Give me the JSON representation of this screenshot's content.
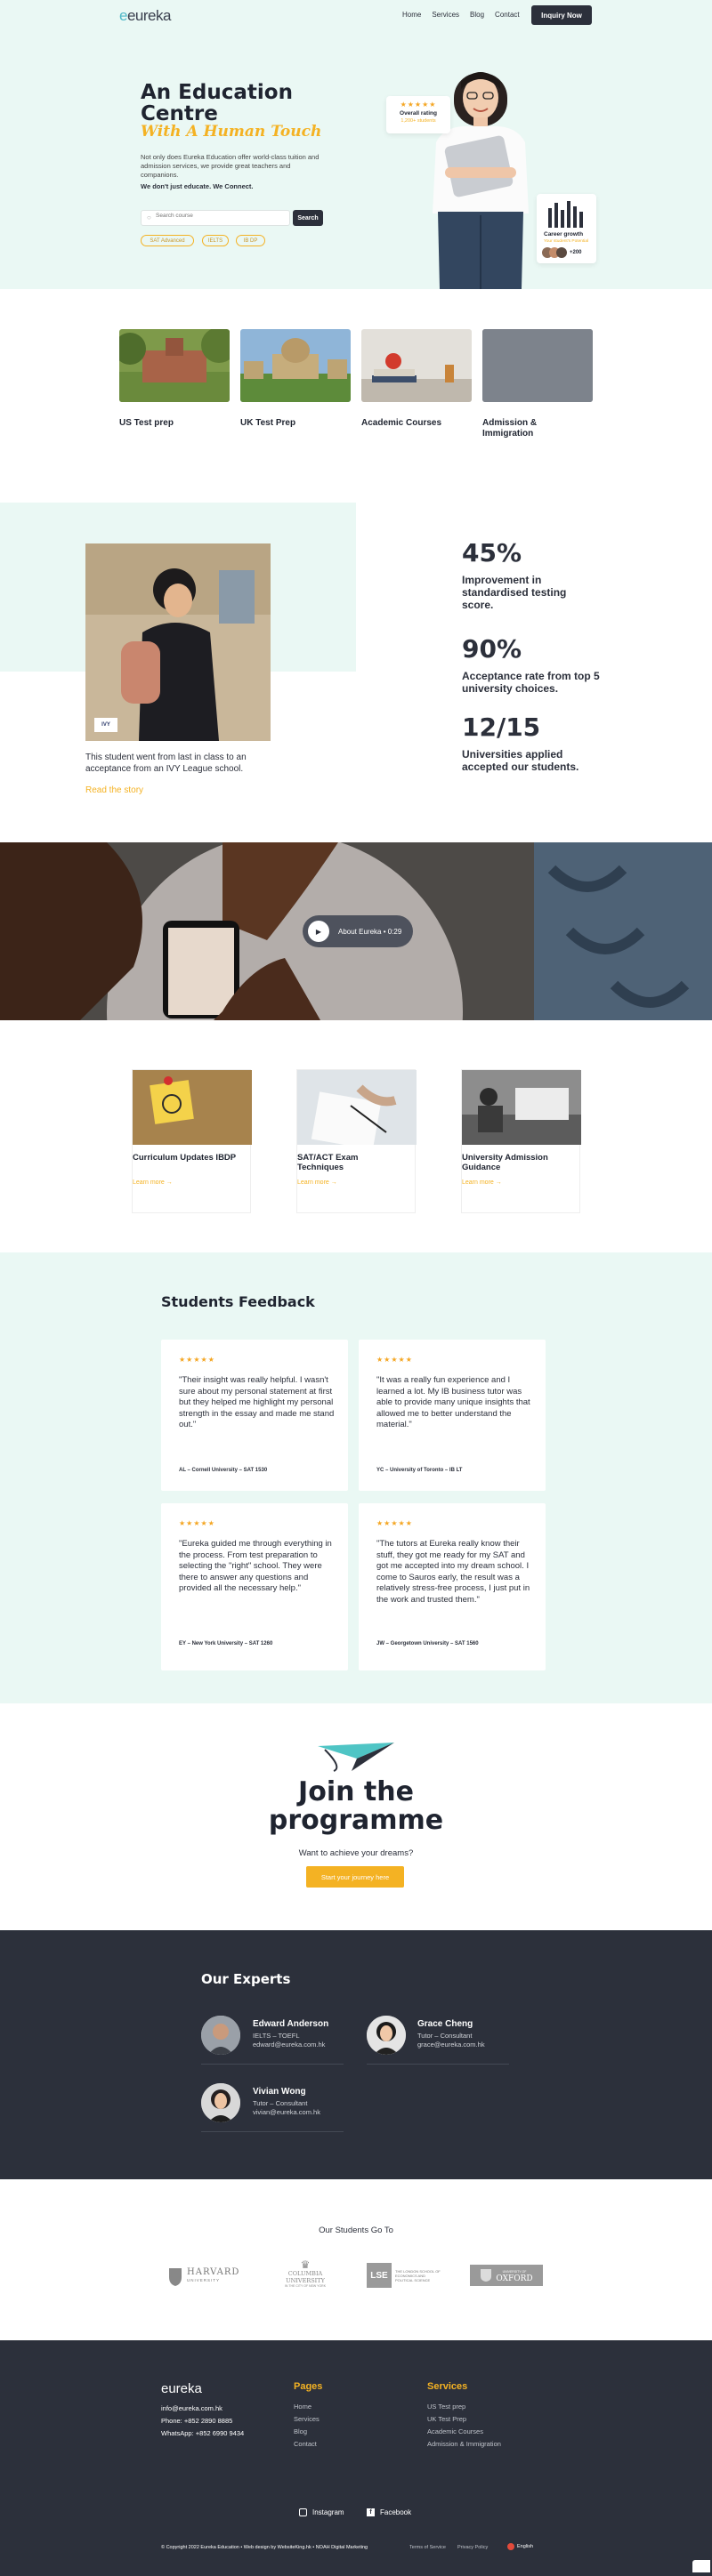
{
  "header": {
    "logo": "eureka",
    "nav": [
      "Home",
      "Services",
      "Blog",
      "Contact"
    ],
    "cta": "Inquiry Now"
  },
  "hero": {
    "title_line1": "An Education",
    "title_line2": "Centre",
    "script": "With A Human Touch",
    "desc": "Not only does Eureka Education offer world-class tuition and admission services, we provide great teachers and companions.",
    "tagline": "We don't just educate. We Connect.",
    "search_placeholder": "Search course",
    "search_button": "Search",
    "tags": [
      "SAT Advanced",
      "IELTS",
      "IB DP"
    ],
    "rating_card": {
      "stars": "★★★★★",
      "title": "Overall rating",
      "sub": "1,200+ students"
    },
    "growth_card": {
      "title": "Career growth",
      "sub": "Your student's Potential",
      "count": "+200"
    }
  },
  "services": [
    {
      "label": "US Test prep"
    },
    {
      "label": "UK Test Prep"
    },
    {
      "label": "Academic Courses"
    },
    {
      "label": "Admission & Immigration"
    }
  ],
  "story": {
    "badge": "IVY",
    "text": "This student went from last in class to an acceptance from an IVY League school.",
    "link": "Read the story"
  },
  "stats": [
    {
      "value": "45%",
      "label": "Improvement in standardised testing score."
    },
    {
      "value": "90%",
      "label": "Acceptance rate from top 5 university choices."
    },
    {
      "value": "12/15",
      "label": "Universities applied accepted our students."
    }
  ],
  "video": {
    "label": "About Eureka • 0:29"
  },
  "knowledge": [
    {
      "title": "Curriculum Updates IBDP",
      "link": "Learn more →"
    },
    {
      "title": "SAT/ACT Exam Techniques",
      "link": "Learn more →"
    },
    {
      "title": "University Admission Guidance",
      "link": "Learn more →"
    }
  ],
  "feedback": {
    "heading": "Students Feedback",
    "items": [
      {
        "stars": "★★★★★",
        "quote": "\"Their insight was really helpful. I wasn't sure about my personal statement at first but they helped me highlight my personal strength in the essay and made me stand out.\"",
        "who": "AL – Cornell University – SAT 1530"
      },
      {
        "stars": "★★★★★",
        "quote": "\"It was a really fun experience and I learned a lot. My IB business tutor was able to provide many unique insights that allowed me to better understand the material.\"",
        "who": "YC – University of Toronto – IB LT"
      },
      {
        "stars": "★★★★★",
        "quote": "\"Eureka guided me through everything in the process. From test preparation to selecting the \"right\" school. They were there to answer any questions and provided all the necessary help.\"",
        "who": "EY – New York University – SAT 1260"
      },
      {
        "stars": "★★★★★",
        "quote": "\"The tutors at Eureka really know their stuff, they got me ready for my SAT and got me accepted into my dream school. I come to Sauros early, the result was a relatively stress-free process, I just put in the work and trusted them.\"",
        "who": "JW – Georgetown University – SAT 1560"
      }
    ]
  },
  "join": {
    "line1": "Join the",
    "line2": "programme",
    "sub": "Want to achieve your dreams?",
    "cta": "Start your journey here"
  },
  "experts": {
    "heading": "Our Experts",
    "people": [
      {
        "name": "Edward Anderson",
        "role": "IELTS – TOEFL",
        "email": "edward@eureka.com.hk"
      },
      {
        "name": "Grace Cheng",
        "role": "Tutor – Consultant",
        "email": "grace@eureka.com.hk"
      },
      {
        "name": "Vivian Wong",
        "role": "Tutor – Consultant",
        "email": "vivian@eureka.com.hk"
      }
    ]
  },
  "unis": {
    "heading": "Our Students Go To",
    "logos": [
      "HARVARD",
      "UNIVERSITY",
      "COLUMBIA UNIVERSITY",
      "IN THE CITY OF NEW YORK",
      "LSE",
      "THE LONDON SCHOOL OF ECONOMICS AND POLITICAL SCIENCE",
      "UNIVERSITY OF",
      "OXFORD"
    ]
  },
  "footer": {
    "logo": "eureka",
    "contact": [
      "info@eureka.com.hk",
      "Phone: +852 2890 8885",
      "WhatsApp: +852 6990 9434"
    ],
    "pages_title": "Pages",
    "pages": [
      "Home",
      "Services",
      "Blog",
      "Contact"
    ],
    "services_title": "Services",
    "services": [
      "US Test prep",
      "UK Test Prep",
      "Academic Courses",
      "Admission & Immigration"
    ],
    "social": [
      "Instagram",
      "Facebook"
    ],
    "copyright": "© Copyright 2022 Eureka Education • Web design by WebsiteKing.hk • NOAH Digital Marketing",
    "terms": "Terms of Service",
    "privacy": "Privacy Policy",
    "lang": "English"
  },
  "colors": {
    "accent": "#f4b223",
    "dark": "#2c303b",
    "mint": "#eaf8f4",
    "teal": "#4fb8c8"
  }
}
